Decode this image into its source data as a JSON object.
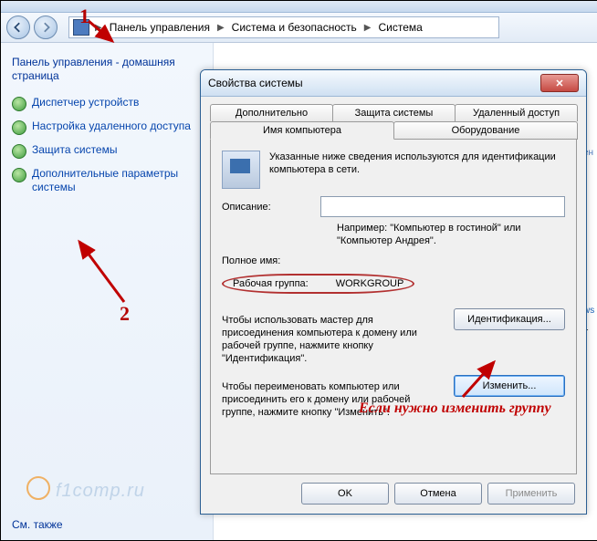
{
  "breadcrumb": {
    "seg1": "Панель управления",
    "seg2": "Система и безопасность",
    "seg3": "Система"
  },
  "sidebar": {
    "header": "Панель управления - домашняя страница",
    "items": [
      {
        "label": "Диспетчер устройств"
      },
      {
        "label": "Настройка удаленного доступа"
      },
      {
        "label": "Защита системы"
      },
      {
        "label": "Дополнительные параметры системы"
      }
    ],
    "see_also": "См. также"
  },
  "watermark": "f1comp.ru",
  "dialog": {
    "title": "Свойства системы",
    "tabs_row1": [
      "Дополнительно",
      "Защита системы",
      "Удаленный доступ"
    ],
    "tabs_row2": [
      "Имя компьютера",
      "Оборудование"
    ],
    "info": "Указанные ниже сведения используются для идентификации компьютера в сети.",
    "desc_label": "Описание:",
    "example": "Например: \"Компьютер в гостиной\" или \"Компьютер Андрея\".",
    "fullname_label": "Полное имя:",
    "workgroup_label": "Рабочая группа:",
    "workgroup_value": "WORKGROUP",
    "help_ident": "Чтобы использовать мастер для присоединения компьютера к домену или рабочей группе, нажмите кнопку \"Идентификация\".",
    "btn_ident": "Идентификация...",
    "help_change": "Чтобы переименовать компьютер или присоединить его к домену или рабочей группе, нажмите кнопку \"Изменить\".",
    "btn_change": "Изменить...",
    "btn_ok": "OK",
    "btn_cancel": "Отмена",
    "btn_apply": "Применить"
  },
  "annotations": {
    "n1": "1",
    "n2": "2",
    "note": "Если нужно изменить группу"
  },
  "clip": {
    "a": "ен",
    "b": "ws",
    "c": "1"
  }
}
